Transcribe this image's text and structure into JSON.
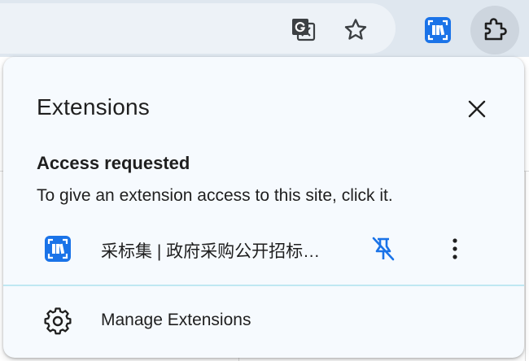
{
  "toolbar": {
    "icons": {
      "translate": "google-translate-icon",
      "bookmark": "star-outline-icon",
      "pinned_extension": "caibiaoji-extension-icon",
      "extensions": "puzzle-piece-icon"
    }
  },
  "popup": {
    "title": "Extensions",
    "close_icon": "close-icon",
    "access_section": {
      "heading": "Access requested",
      "description": "To give an extension access to this site, click it."
    },
    "extensions": [
      {
        "name": "采标集 | 政府采购公开招标信息",
        "icon": "caibiaoji-extension-icon",
        "pin_icon": "unpin-icon",
        "more_icon": "more-vertical-icon"
      }
    ],
    "manage": {
      "label": "Manage Extensions",
      "icon": "gear-icon"
    }
  },
  "colors": {
    "toolbar_bg": "#dfe7ef",
    "omnibox_bg": "#edf2f7",
    "popup_bg": "#f6fafe",
    "accent_blue": "#1a73e8",
    "text": "#1f1f1f"
  }
}
